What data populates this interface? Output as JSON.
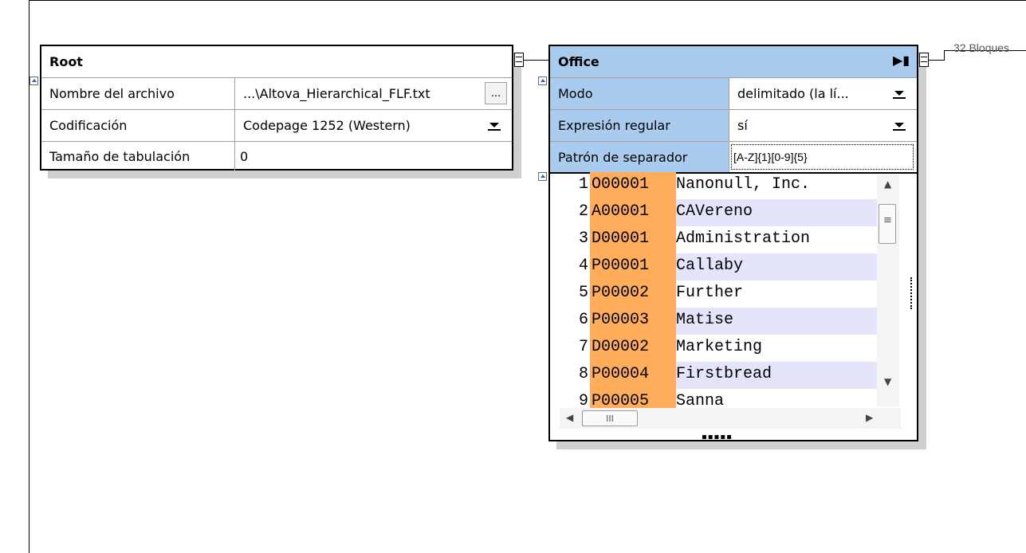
{
  "root_box": {
    "title": "Root",
    "rows": [
      {
        "label": "Nombre del archivo",
        "value": "...\\Altova_Hierarchical_FLF.txt",
        "button": "..."
      },
      {
        "label": "Codificación",
        "value": "Codepage 1252 (Western)"
      },
      {
        "label": "Tamaño de tabulación",
        "value": "0"
      }
    ]
  },
  "office_box": {
    "title": "Office",
    "rows": [
      {
        "label": "Modo",
        "value": "delimitado (la lí..."
      },
      {
        "label": "Expresión regular",
        "value": "sí"
      },
      {
        "label": "Patrón de separador",
        "value": "[A-Z]{1}[0-9]{5}"
      }
    ],
    "lines": [
      {
        "num": "1",
        "id": "O00001",
        "text": "Nanonull, Inc."
      },
      {
        "num": "2",
        "id": "A00001",
        "text": "CAVereno"
      },
      {
        "num": "3",
        "id": "D00001",
        "text": "Administration"
      },
      {
        "num": "4",
        "id": "P00001",
        "text": "Callaby"
      },
      {
        "num": "5",
        "id": "P00002",
        "text": "Further"
      },
      {
        "num": "6",
        "id": "P00003",
        "text": "Matise"
      },
      {
        "num": "7",
        "id": "D00002",
        "text": "Marketing"
      },
      {
        "num": "8",
        "id": "P00004",
        "text": "Firstbread"
      },
      {
        "num": "9",
        "id": "P00005",
        "text": "Sanna"
      }
    ]
  },
  "blocks_label": "32 Bloques",
  "colors": {
    "header_blue": "#a9cbee",
    "id_highlight": "#ffad5a",
    "row_stripe": "#e4e4fb"
  }
}
